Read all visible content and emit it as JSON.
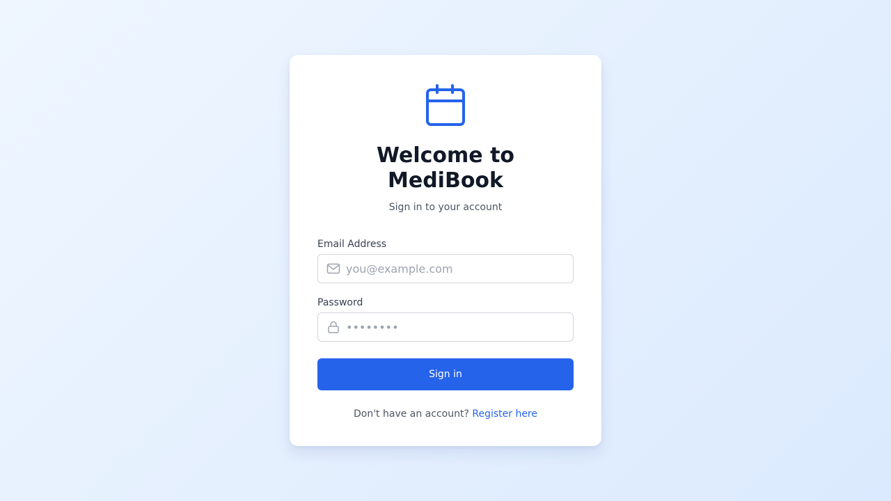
{
  "app": {
    "icon": "calendar-icon",
    "title": "Welcome to MediBook",
    "subtitle": "Sign in to your account"
  },
  "form": {
    "email": {
      "label": "Email Address",
      "placeholder": "you@example.com",
      "value": "",
      "icon": "mail-icon"
    },
    "password": {
      "label": "Password",
      "placeholder": "••••••••",
      "value": "",
      "icon": "lock-icon"
    },
    "submit_label": "Sign in"
  },
  "footer": {
    "prompt": "Don't have an account?",
    "link_label": "Register here"
  },
  "colors": {
    "accent": "#2563eb",
    "title": "#111827",
    "muted": "#4b5563",
    "background_start": "#eff6ff",
    "background_end": "#dbeafe"
  }
}
